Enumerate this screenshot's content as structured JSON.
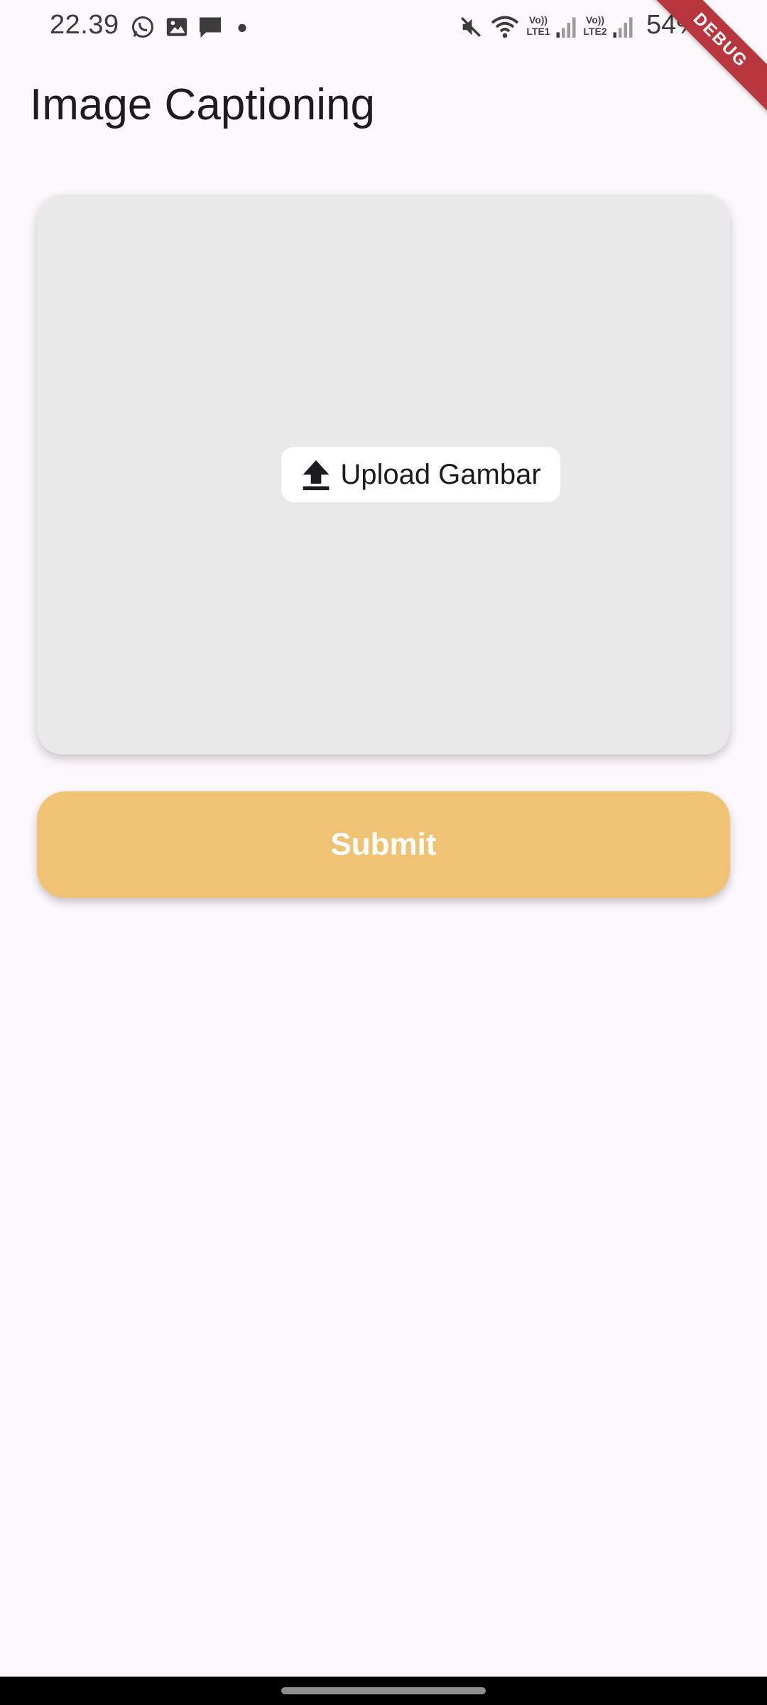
{
  "status_bar": {
    "time": "22.39",
    "battery": "54%",
    "icons": [
      "whatsapp-icon",
      "gallery-icon",
      "message-icon",
      "dot-icon",
      "mute-icon",
      "wifi-icon",
      "signal-lte1-icon",
      "signal-lte2-icon",
      "battery-icon"
    ],
    "sim1_label_top": "Vo))",
    "sim1_label_bottom": "LTE1",
    "sim2_label_top": "Vo))",
    "sim2_label_bottom": "LTE2"
  },
  "debug_banner": {
    "label": "DEBUG"
  },
  "app": {
    "title": "Image Captioning"
  },
  "upload": {
    "button_label": "Upload Gambar",
    "icon": "upload-icon"
  },
  "submit": {
    "label": "Submit"
  },
  "colors": {
    "background": "#fdf8fc",
    "card": "#e9e9e9",
    "submit": "#efc373",
    "debug": "#b8373f"
  }
}
